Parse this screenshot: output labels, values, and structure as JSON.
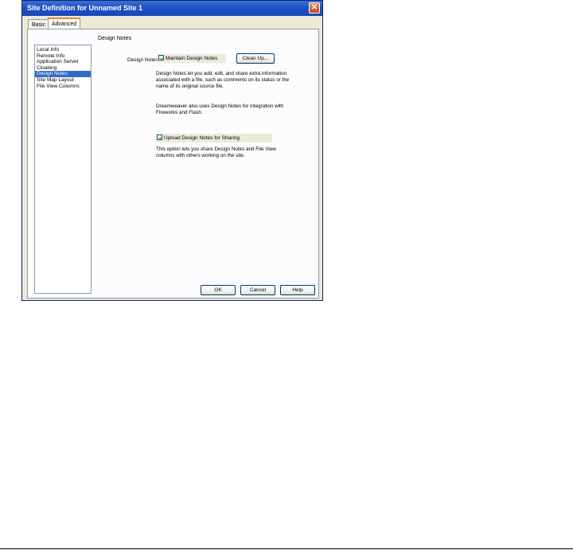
{
  "window": {
    "title": "Site Definition for Unnamed Site 1",
    "close_glyph": "✕"
  },
  "tabs": [
    {
      "label": "Basic",
      "selected": false
    },
    {
      "label": "Advanced",
      "selected": true
    }
  ],
  "category_list": {
    "items": [
      "Local Info",
      "Remote Info",
      "Application Server",
      "Cloaking",
      "Design Notes",
      "Site Map Layout",
      "File View Columns"
    ],
    "selected": "Design Notes"
  },
  "design_notes": {
    "section_title": "Design Notes",
    "field_label": "Design Notes:",
    "maintain_label": "Maintain Design Notes",
    "maintain_checked": true,
    "cleanup_label": "Clean Up...",
    "description_1": "Design Notes let you add, edit, and share extra information associated with a file, such as comments on its status or the name of its original source file.",
    "description_2": "Dreamweaver also uses Design Notes for integration with Fireworks and Flash.",
    "upload_label": "Upload Design Notes for Sharing",
    "upload_checked": true,
    "description_3": "This option lets you share Design Notes and File View columns with others working on the site."
  },
  "buttons": {
    "ok": "OK",
    "cancel": "Cancel",
    "help": "Help"
  },
  "colors": {
    "titlebar": "#1c4fc4",
    "selection": "#316ac5",
    "dialog_bg": "#ece9d8"
  }
}
